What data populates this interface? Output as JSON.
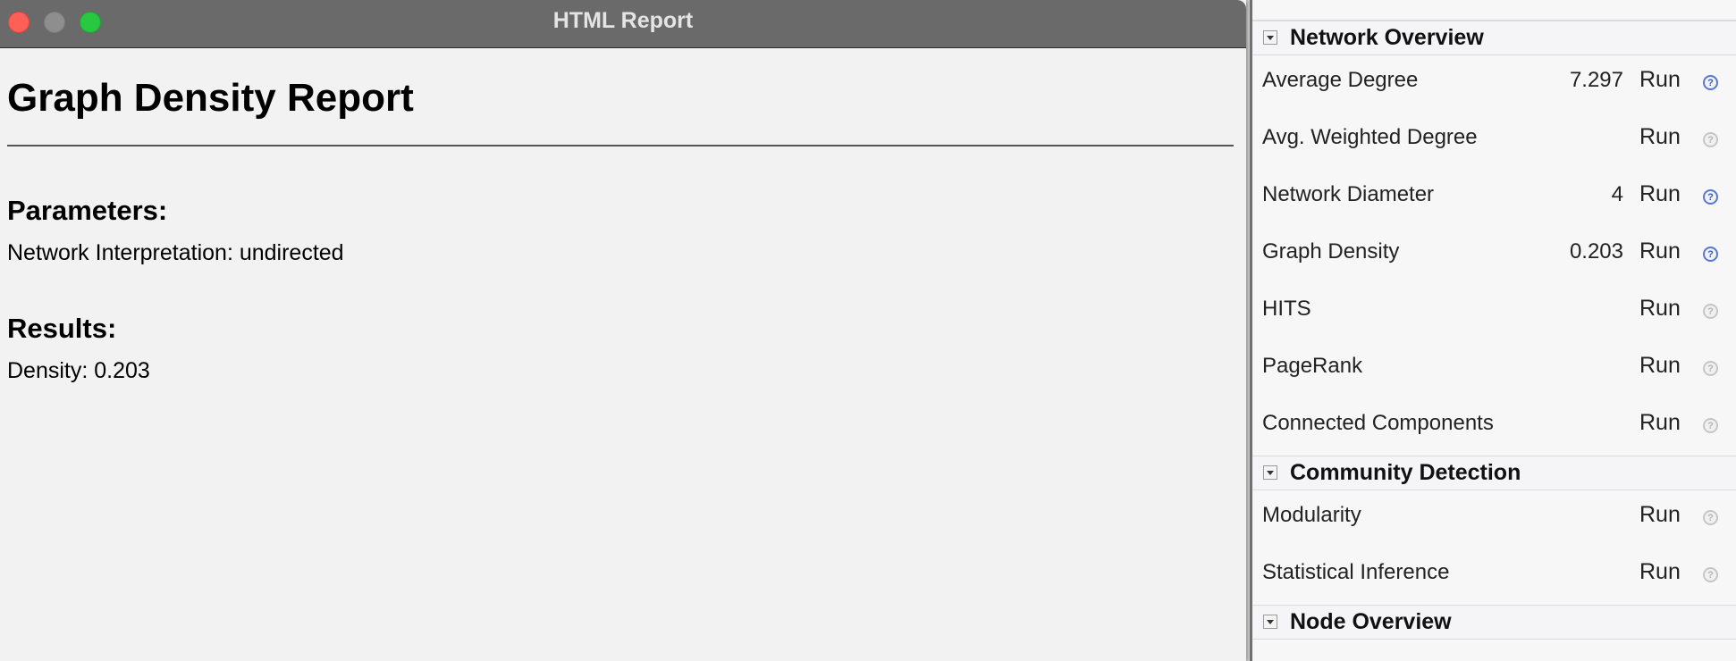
{
  "report_window": {
    "title": "HTML Report",
    "heading": "Graph Density Report",
    "parameters_heading": "Parameters:",
    "parameters_text": "Network Interpretation: undirected",
    "results_heading": "Results:",
    "results_text": "Density: 0.203"
  },
  "stats_panel": {
    "run_label": "Run",
    "help_glyph": "?",
    "network_overview": {
      "title": "Network Overview",
      "items": [
        {
          "name": "Average Degree",
          "value": "7.297",
          "help_active": true
        },
        {
          "name": "Avg. Weighted Degree",
          "value": "",
          "help_active": false
        },
        {
          "name": "Network Diameter",
          "value": "4",
          "help_active": true
        },
        {
          "name": "Graph Density",
          "value": "0.203",
          "help_active": true
        },
        {
          "name": "HITS",
          "value": "",
          "help_active": false
        },
        {
          "name": "PageRank",
          "value": "",
          "help_active": false
        },
        {
          "name": "Connected Components",
          "value": "",
          "help_active": false
        }
      ]
    },
    "community_detection": {
      "title": "Community Detection",
      "items": [
        {
          "name": "Modularity",
          "value": "",
          "help_active": false
        },
        {
          "name": "Statistical Inference",
          "value": "",
          "help_active": false
        }
      ]
    },
    "node_overview": {
      "title": "Node Overview"
    }
  },
  "colors": {
    "help_active": "#3d5bb0",
    "help_inactive": "#b5b5b5",
    "close": "#fe5f57",
    "minimize": "#8e8e8e",
    "maximize": "#28c840"
  }
}
